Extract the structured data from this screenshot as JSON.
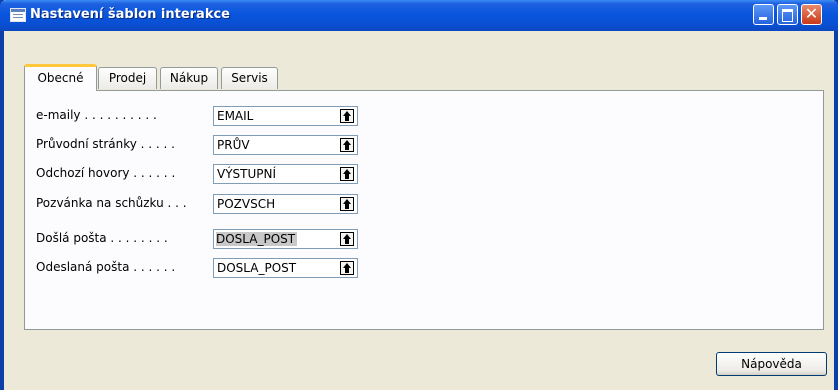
{
  "window": {
    "title": "Nastavení šablon interakce",
    "close_glyph": "✕"
  },
  "tabs": [
    {
      "label": "Obecné",
      "active": true
    },
    {
      "label": "Prodej",
      "active": false
    },
    {
      "label": "Nákup",
      "active": false
    },
    {
      "label": "Servis",
      "active": false
    }
  ],
  "fields": [
    {
      "label": "e-maily . . . . . . . . . .",
      "value": "EMAIL"
    },
    {
      "label": "Průvodní stránky . . . . .",
      "value": "PRŮV"
    },
    {
      "label": "Odchozí hovory . . . . . .",
      "value": "VÝSTUPNÍ"
    },
    {
      "label": "Pozvánka na schůzku . . .",
      "value": "POZVSCH"
    },
    {
      "label": "Došlá pošta . . . . . . . .",
      "value": "DOSLA_POST",
      "selected": true
    },
    {
      "label": "Odeslaná pošta . . . . . .",
      "value": "DOSLA_POST"
    }
  ],
  "buttons": {
    "help_label": "Nápověda"
  },
  "icons": {
    "window_icon": "table-icon",
    "lookup_icon": "up-arrow-lookup-icon"
  },
  "colors": {
    "titlebar": "#0856de",
    "tab_highlight": "#ffc83c",
    "dialog_bg": "#ece9d8"
  }
}
